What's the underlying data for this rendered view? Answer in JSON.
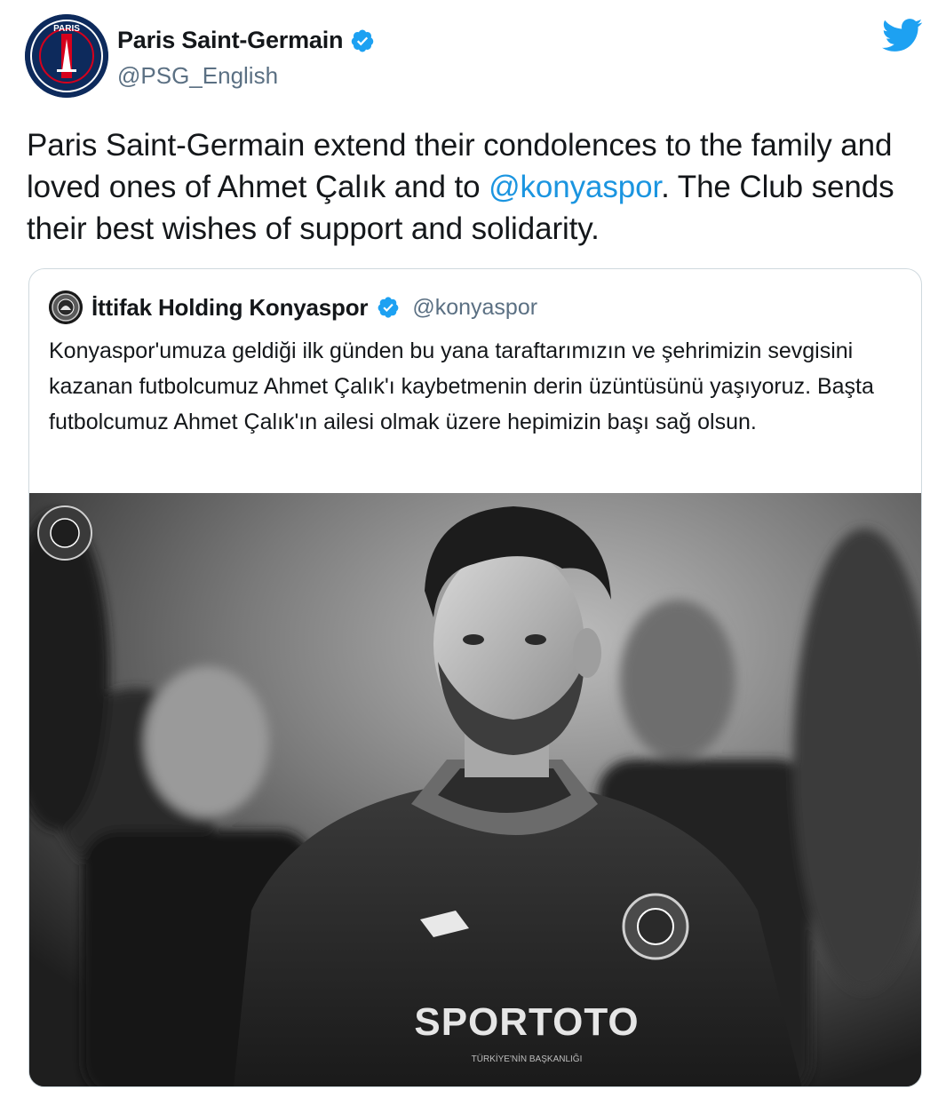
{
  "author": {
    "name": "Paris Saint-Germain",
    "handle": "@PSG_English",
    "avatar_icon": "psg-crest-icon",
    "verified_icon": "verified-badge-icon",
    "avatar_crest_text": "PARIS"
  },
  "platform_icon": "twitter-bird-icon",
  "tweet": {
    "text_part1": "Paris Saint-Germain extend their condolences to the family and loved ones of Ahmet Çalık and to ",
    "mention": "@konyaspor",
    "text_part2": ". The Club sends their best wishes of support and solidarity."
  },
  "quoted": {
    "name": "İttifak Holding Konyaspor",
    "handle": "@konyaspor",
    "avatar_icon": "konyaspor-crest-icon",
    "verified_icon": "verified-badge-icon",
    "text": "Konyaspor'umuza geldiği ilk günden bu yana taraftarımızın ve şehrimizin sevgisini kazanan futbolcumuz Ahmet Çalık'ı kaybetmenin derin üzüntüsünü yaşıyoruz. Başta futbolcumuz Ahmet Çalık'ın ailesi olmak üzere hepimizin başı sağ olsun.",
    "photo": {
      "description_icon": "player-photo-image",
      "sponsor_text": "SPORTOTO",
      "sponsor_subtext": "TÜRKİYE'NİN BAŞKANLIĞI"
    }
  },
  "colors": {
    "link": "#1b95e0",
    "verified": "#1da1f2",
    "handle": "#5b7083",
    "psg_navy": "#0d2a5c",
    "psg_red": "#d6001c"
  }
}
